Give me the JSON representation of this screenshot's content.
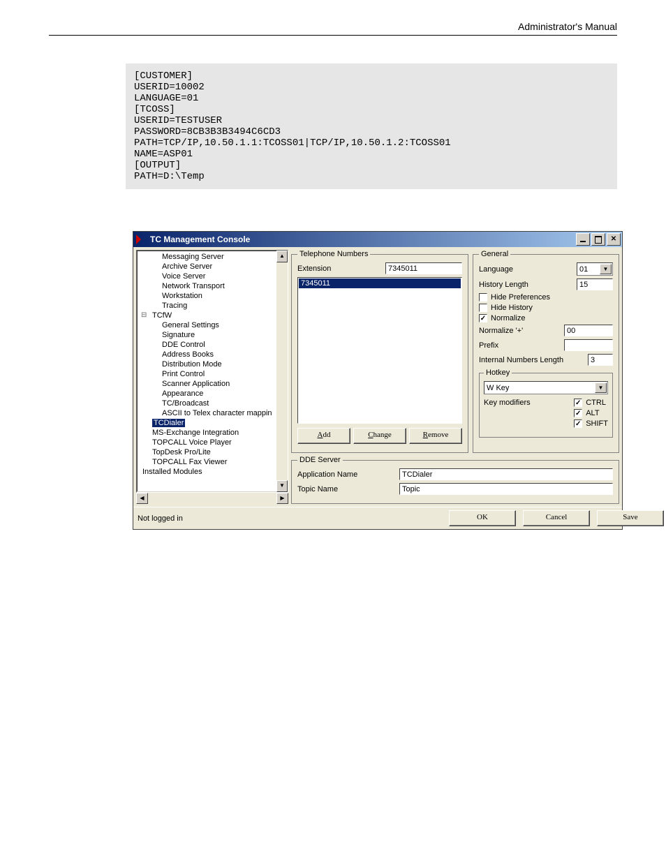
{
  "doc_header": "Administrator's Manual",
  "code": "[CUSTOMER]\nUSERID=10002\nLANGUAGE=01\n[TCOSS]\nUSERID=TESTUSER\nPASSWORD=8CB3B3B3494C6CD3\nPATH=TCP/IP,10.50.1.1:TCOSS01|TCP/IP,10.50.1.2:TCOSS01\nNAME=ASP01\n[OUTPUT]\nPATH=D:\\Temp",
  "window": {
    "title": "TC Management Console"
  },
  "tree": {
    "items": [
      {
        "label": "Messaging Server",
        "lvl": 2
      },
      {
        "label": "Archive Server",
        "lvl": 2
      },
      {
        "label": "Voice Server",
        "lvl": 2
      },
      {
        "label": "Network Transport",
        "lvl": 2
      },
      {
        "label": "Workstation",
        "lvl": 2
      },
      {
        "label": "Tracing",
        "lvl": 2
      },
      {
        "label": "TCfW",
        "node": true,
        "lvl": 1
      },
      {
        "label": "General Settings",
        "lvl": 2
      },
      {
        "label": "Signature",
        "lvl": 2
      },
      {
        "label": "DDE Control",
        "lvl": 2
      },
      {
        "label": "Address Books",
        "lvl": 2
      },
      {
        "label": "Distribution Mode",
        "lvl": 2
      },
      {
        "label": "Print Control",
        "lvl": 2
      },
      {
        "label": "Scanner Application",
        "lvl": 2
      },
      {
        "label": "Appearance",
        "lvl": 2
      },
      {
        "label": "TC/Broadcast",
        "lvl": 2
      },
      {
        "label": "ASCII to Telex character mappin",
        "lvl": 2
      },
      {
        "label": "TCDialer",
        "selected": true,
        "lvl": 1
      },
      {
        "label": "MS-Exchange Integration",
        "lvl": 1
      },
      {
        "label": "TOPCALL Voice Player",
        "lvl": 1
      },
      {
        "label": "TopDesk Pro/Lite",
        "lvl": 1
      },
      {
        "label": "TOPCALL Fax Viewer",
        "lvl": 1
      },
      {
        "label": "Installed Modules",
        "lvl": 0
      }
    ]
  },
  "tel": {
    "legend": "Telephone Numbers",
    "ext_label": "Extension",
    "ext_value": "7345011",
    "list_item": "7345011",
    "add": "Add",
    "change": "Change",
    "remove": "Remove"
  },
  "gen": {
    "legend": "General",
    "lang_label": "Language",
    "lang_value": "01",
    "hist_label": "History Length",
    "hist_value": "15",
    "hide_pref": "Hide Preferences",
    "hide_hist": "Hide History",
    "normalize": "Normalize",
    "norm_plus_label": "Normalize '+'",
    "norm_plus_value": "00",
    "prefix_label": "Prefix",
    "prefix_value": "",
    "int_len_label": "Internal Numbers Length",
    "int_len_value": "3",
    "hotkey_legend": "Hotkey",
    "hotkey_value": "W Key",
    "keymod_label": "Key modifiers",
    "ctrl": "CTRL",
    "alt": "ALT",
    "shift": "SHIFT"
  },
  "dde": {
    "legend": "DDE Server",
    "app_label": "Application Name",
    "app_value": "TCDialer",
    "topic_label": "Topic Name",
    "topic_value": "Topic"
  },
  "status": "Not logged in",
  "buttons": {
    "ok": "OK",
    "cancel": "Cancel",
    "save": "Save"
  }
}
